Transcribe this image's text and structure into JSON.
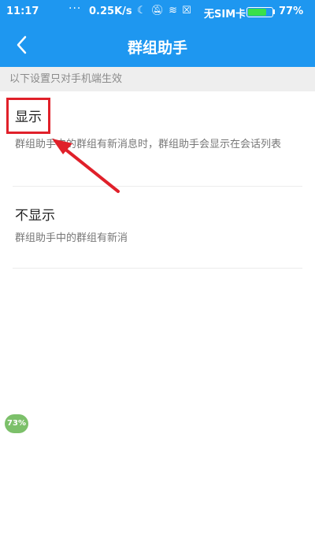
{
  "status_bar": {
    "time": "11:17",
    "dots": "···",
    "speed": "0.25K/s",
    "carrier": "无SIM卡",
    "battery_pct": "77%",
    "battery_level": 0.77,
    "icons": [
      "moon-icon",
      "bell-off-icon",
      "wifi-icon",
      "no-sim-icon",
      "battery-icon"
    ]
  },
  "navbar": {
    "title": "群组助手",
    "back_icon": "chevron-left-icon"
  },
  "hint": "以下设置只对手机端生效",
  "options": [
    {
      "label": "显示",
      "description": "群组助手中的群组有新消息时，群组助手会显示在会话列表"
    },
    {
      "label": "不显示",
      "description": "群组助手中的群组有新消"
    }
  ],
  "badge": "73%",
  "colors": {
    "header_blue": "#1e97f0",
    "highlight_red": "#e0202a",
    "badge_green": "#7cc06a"
  }
}
